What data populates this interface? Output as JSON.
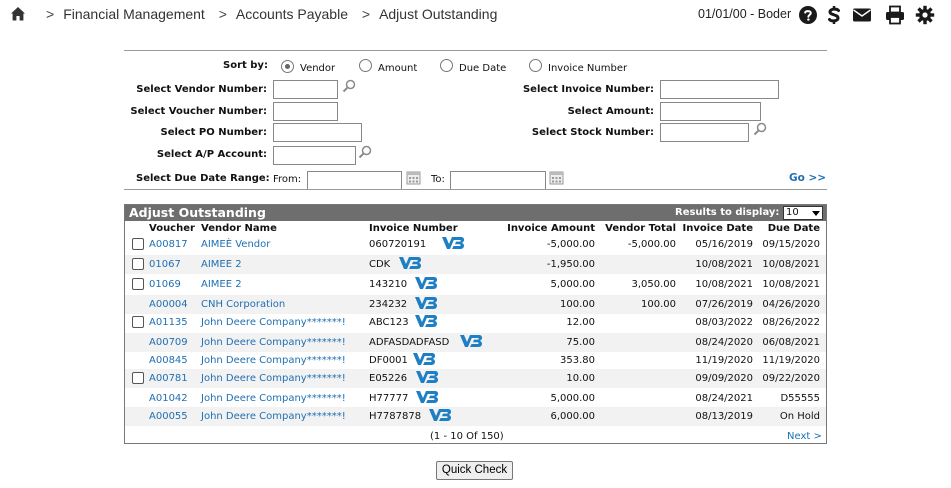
{
  "breadcrumb": {
    "items": [
      "Financial Management",
      "Accounts Payable",
      "Adjust Outstanding"
    ],
    "separator": ">"
  },
  "header": {
    "date_user": "01/01/00 - Boder",
    "icons": [
      "help-icon",
      "s-dollar-icon",
      "mail-icon",
      "print-icon",
      "gear-icon"
    ]
  },
  "filters": {
    "sort_by_label": "Sort by:",
    "sort_options": [
      "Vendor",
      "Amount",
      "Due Date",
      "Invoice Number"
    ],
    "sort_selected": "Vendor",
    "vendor_number_label": "Select Vendor Number:",
    "voucher_number_label": "Select Voucher Number:",
    "po_number_label": "Select PO Number:",
    "ap_account_label": "Select A/P Account:",
    "invoice_number_label": "Select Invoice Number:",
    "amount_label": "Select Amount:",
    "stock_number_label": "Select Stock Number:",
    "due_date_range_label": "Select Due Date Range:",
    "from_label": "From:",
    "to_label": "To:",
    "go_label": "Go >>"
  },
  "results": {
    "title": "Adjust Outstanding",
    "results_to_display_label": "Results to display:",
    "results_to_display_value": "10",
    "columns": [
      "Voucher",
      "Vendor Name",
      "Invoice Number",
      "Invoice Amount",
      "Vendor Total",
      "Invoice Date",
      "Due Date"
    ],
    "rows": [
      {
        "checkbox": true,
        "voucher": "A00817",
        "vendor": "AIMEÈ Vendor",
        "invoice": "060720191",
        "amount": "-5,000.00",
        "vendor_total": "-5,000.00",
        "invoice_date": "05/16/2019",
        "due_date": "09/15/2020"
      },
      {
        "checkbox": true,
        "voucher": "01067",
        "vendor": "AIMEE 2",
        "invoice": "CDK",
        "amount": "-1,950.00",
        "vendor_total": "",
        "invoice_date": "10/08/2021",
        "due_date": "10/08/2021"
      },
      {
        "checkbox": true,
        "voucher": "01069",
        "vendor": "AIMEE 2",
        "invoice": "143210",
        "amount": "5,000.00",
        "vendor_total": "3,050.00",
        "invoice_date": "10/08/2021",
        "due_date": "10/08/2021"
      },
      {
        "checkbox": false,
        "voucher": "A00004",
        "vendor": "CNH Corporation",
        "invoice": "234232",
        "amount": "100.00",
        "vendor_total": "100.00",
        "invoice_date": "07/26/2019",
        "due_date": "04/26/2020"
      },
      {
        "checkbox": true,
        "voucher": "A01135",
        "vendor": "John Deere Company*******!",
        "invoice": "ABC123",
        "amount": "12.00",
        "vendor_total": "",
        "invoice_date": "08/03/2022",
        "due_date": "08/26/2022"
      },
      {
        "checkbox": false,
        "voucher": "A00709",
        "vendor": "John Deere Company*******!",
        "invoice": "ADFASDADFASD",
        "amount": "75.00",
        "vendor_total": "",
        "invoice_date": "08/24/2020",
        "due_date": "06/08/2021"
      },
      {
        "checkbox": false,
        "voucher": "A00845",
        "vendor": "John Deere Company*******!",
        "invoice": "DF0001",
        "amount": "353.80",
        "vendor_total": "",
        "invoice_date": "11/19/2020",
        "due_date": "11/19/2020"
      },
      {
        "checkbox": true,
        "voucher": "A00781",
        "vendor": "John Deere Company*******!",
        "invoice": "E05226",
        "amount": "10.00",
        "vendor_total": "",
        "invoice_date": "09/09/2020",
        "due_date": "09/22/2020"
      },
      {
        "checkbox": false,
        "voucher": "A01042",
        "vendor": "John Deere Company*******!",
        "invoice": "H77777",
        "amount": "5,000.00",
        "vendor_total": "",
        "invoice_date": "08/24/2021",
        "due_date": "D55555"
      },
      {
        "checkbox": false,
        "voucher": "A00055",
        "vendor": "John Deere Company*******!",
        "invoice": "H7787878",
        "amount": "6,000.00",
        "vendor_total": "",
        "invoice_date": "08/13/2019",
        "due_date": "On Hold"
      }
    ],
    "pager": "(1 - 10 Of 150)",
    "next_label": "Next >"
  },
  "quick_check_label": "Quick Check",
  "colors": {
    "link": "#1f6fb2",
    "panel_header": "#6e6e6e",
    "row_alt": "#f2f2f2"
  }
}
